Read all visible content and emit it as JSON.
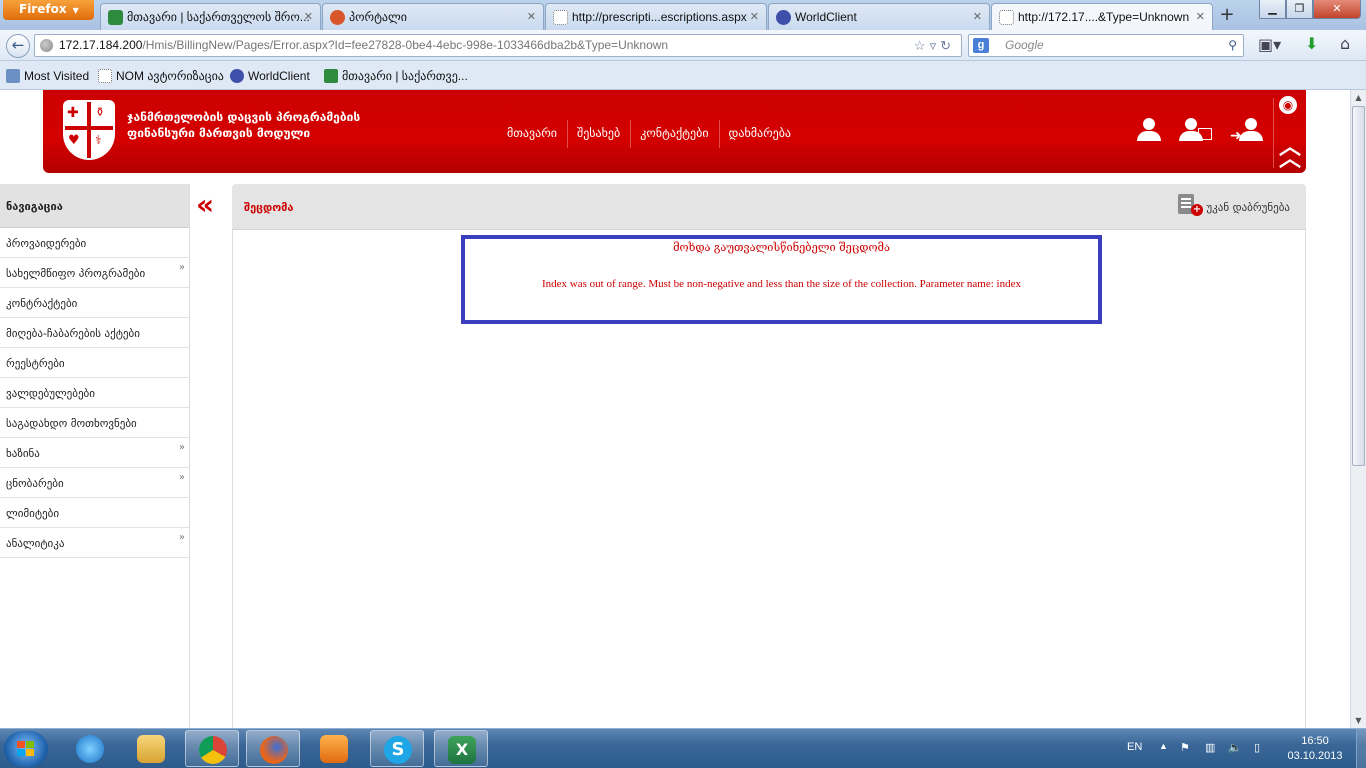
{
  "browser": {
    "app_button": "Firefox",
    "tabs": [
      {
        "label": "მთავარი   | საქართველოს შრო..."
      },
      {
        "label": "პორტალი"
      },
      {
        "label": "http://prescripti...escriptions.aspx"
      },
      {
        "label": "WorldClient"
      },
      {
        "label": "http://172.17....&Type=Unknown"
      }
    ],
    "url_host": "172.17.184.200",
    "url_path": "/Hmis/BillingNew/Pages/Error.aspx?Id=fee27828-0be4-4ebc-998e-1033466dba2b&Type=Unknown",
    "search_placeholder": "Google",
    "bookmarks": [
      "Most Visited",
      "NOM ავტორიზაცია",
      "WorldClient",
      "მთავარი   | საქართვე..."
    ]
  },
  "site": {
    "brand_line1": "ჯანმრთელობის დაცვის პროგრამების",
    "brand_line2": "ფინანსური მართვის მოდული",
    "menu": [
      "მთავარი",
      "შესახებ",
      "კონტაქტები",
      "დახმარება"
    ]
  },
  "sidebar": {
    "title": "ნავიგაცია",
    "items": [
      {
        "label": "პროვაიდერები",
        "chevron": ""
      },
      {
        "label": "სახელმწიფო პროგრამები",
        "chevron": "»"
      },
      {
        "label": "კონტრაქტები",
        "chevron": ""
      },
      {
        "label": "მიღება-ჩაბარების აქტები",
        "chevron": ""
      },
      {
        "label": "რეესტრები",
        "chevron": ""
      },
      {
        "label": "ვალდებულებები",
        "chevron": ""
      },
      {
        "label": "საგადახდო მოთხოვნები",
        "chevron": ""
      },
      {
        "label": "ხაზინა",
        "chevron": "»"
      },
      {
        "label": "ცნობარები",
        "chevron": "»"
      },
      {
        "label": "ლიმიტები",
        "chevron": ""
      },
      {
        "label": "ანალიტიკა",
        "chevron": "»"
      }
    ]
  },
  "panel": {
    "title": "შეცდომა",
    "back_label": "უკან დაბრუნება"
  },
  "error": {
    "heading": "მოხდა გაუთვალისწინებელი შეცდომა",
    "message": "Index was out of range. Must be non-negative and less than the size of the collection. Parameter name: index"
  },
  "taskbar": {
    "language": "EN",
    "time": "16:50",
    "date": "03.10.2013"
  },
  "colors": {
    "brand_red": "#cc0000",
    "error_border": "#3b3fbd"
  }
}
